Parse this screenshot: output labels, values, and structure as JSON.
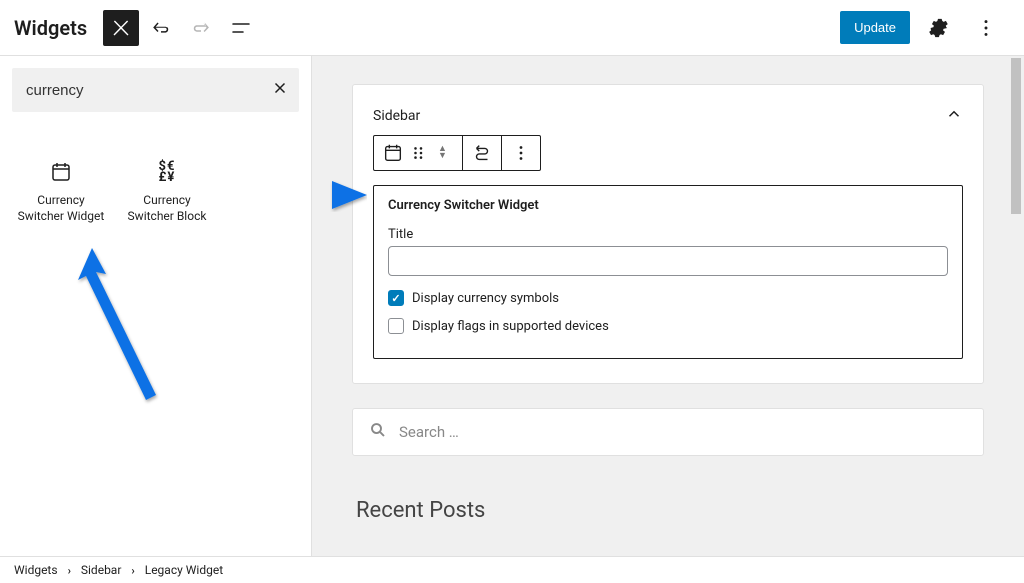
{
  "topbar": {
    "title": "Widgets",
    "update_label": "Update"
  },
  "block_search": {
    "value": "currency"
  },
  "block_results": [
    {
      "label": "Currency Switcher Widget",
      "icon": "calendar"
    },
    {
      "label": "Currency Switcher Block",
      "icon": "currencies"
    }
  ],
  "sidebar": {
    "label": "Sidebar"
  },
  "widget": {
    "heading": "Currency Switcher Widget",
    "title_label": "Title",
    "title_value": "",
    "options": [
      {
        "label": "Display currency symbols",
        "checked": true
      },
      {
        "label": "Display flags in supported devices",
        "checked": false
      }
    ]
  },
  "search_block": {
    "placeholder": "Search …"
  },
  "recent_posts": {
    "heading": "Recent Posts"
  },
  "breadcrumb": [
    "Widgets",
    "Sidebar",
    "Legacy Widget"
  ]
}
